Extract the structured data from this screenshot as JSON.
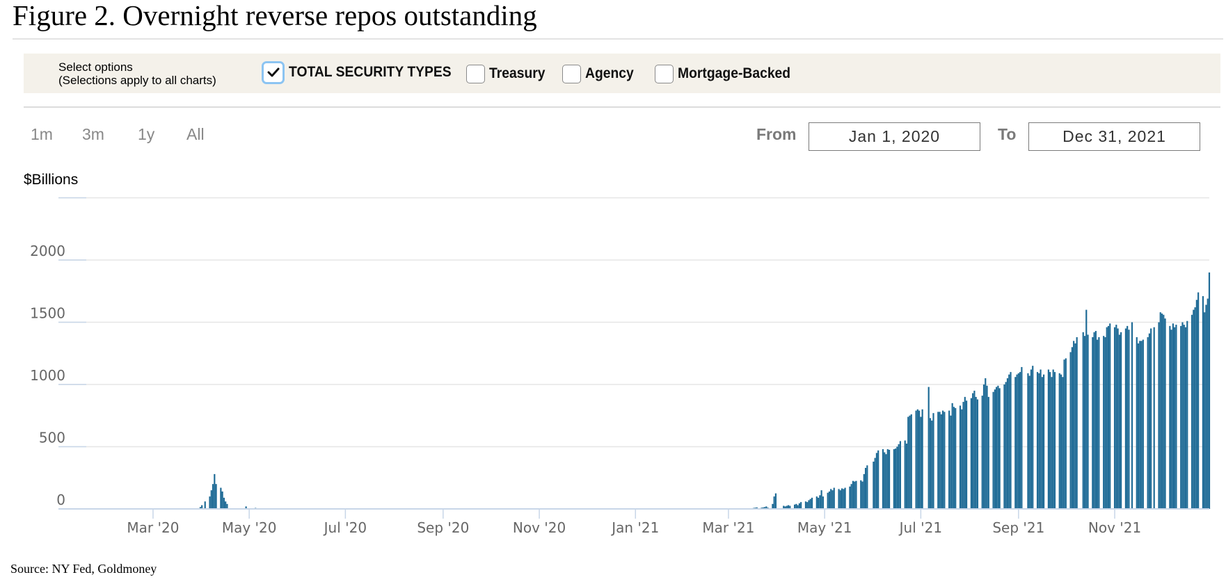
{
  "figure_title": "Figure 2. Overnight reverse repos outstanding",
  "options": {
    "label_line1": "Select options",
    "label_line2": "(Selections apply to all charts)",
    "checkboxes": [
      {
        "label": "TOTAL SECURITY TYPES",
        "checked": true
      },
      {
        "label": "Treasury",
        "checked": false
      },
      {
        "label": "Agency",
        "checked": false
      },
      {
        "label": "Mortgage-Backed",
        "checked": false
      }
    ]
  },
  "range_buttons": [
    "1m",
    "3m",
    "1y",
    "All"
  ],
  "date_range": {
    "from_label": "From",
    "from_value": "Jan 1, 2020",
    "to_label": "To",
    "to_value": "Dec 31, 2021"
  },
  "colors": {
    "bar": "#1f6b96",
    "grid": "#e6e6e6",
    "axis": "#c8d6e8"
  },
  "source": "Source: NY Fed, Goldmoney",
  "chart_data": {
    "type": "bar",
    "title": "Figure 2. Overnight reverse repos outstanding",
    "xlabel": "",
    "ylabel": "$Billions",
    "ylim": [
      0,
      2500
    ],
    "yticks": [
      0,
      500,
      1000,
      1500,
      2000
    ],
    "xticks": [
      {
        "label": "Mar '20",
        "date": "2020-03-01"
      },
      {
        "label": "May '20",
        "date": "2020-05-01"
      },
      {
        "label": "Jul '20",
        "date": "2020-07-01"
      },
      {
        "label": "Sep '20",
        "date": "2020-09-01"
      },
      {
        "label": "Nov '20",
        "date": "2020-11-01"
      },
      {
        "label": "Jan '21",
        "date": "2021-01-01"
      },
      {
        "label": "Mar '21",
        "date": "2021-03-01"
      },
      {
        "label": "May '21",
        "date": "2021-05-01"
      },
      {
        "label": "Jul '21",
        "date": "2021-07-01"
      },
      {
        "label": "Sep '21",
        "date": "2021-09-01"
      },
      {
        "label": "Nov '21",
        "date": "2021-11-01"
      }
    ],
    "grid": true,
    "series": [
      {
        "values_description_note": "",
        "points": [
          [
            "2020-01-16",
            5
          ],
          [
            "2020-03-19",
            5
          ],
          [
            "2020-03-31",
            15
          ],
          [
            "2020-04-01",
            30
          ],
          [
            "2020-04-03",
            60
          ],
          [
            "2020-04-06",
            100
          ],
          [
            "2020-04-07",
            150
          ],
          [
            "2020-04-08",
            200
          ],
          [
            "2020-04-09",
            280
          ],
          [
            "2020-04-10",
            200
          ],
          [
            "2020-04-13",
            170
          ],
          [
            "2020-04-14",
            140
          ],
          [
            "2020-04-15",
            90
          ],
          [
            "2020-04-16",
            60
          ],
          [
            "2020-04-17",
            40
          ],
          [
            "2020-04-29",
            20
          ],
          [
            "2020-05-05",
            8
          ],
          [
            "2021-03-17",
            8
          ],
          [
            "2021-03-18",
            10
          ],
          [
            "2021-03-19",
            12
          ],
          [
            "2021-03-22",
            10
          ],
          [
            "2021-03-23",
            12
          ],
          [
            "2021-03-24",
            15
          ],
          [
            "2021-03-25",
            20
          ],
          [
            "2021-03-26",
            10
          ],
          [
            "2021-03-29",
            40
          ],
          [
            "2021-03-30",
            100
          ],
          [
            "2021-03-31",
            125
          ],
          [
            "2021-04-05",
            25
          ],
          [
            "2021-04-06",
            20
          ],
          [
            "2021-04-07",
            25
          ],
          [
            "2021-04-08",
            30
          ],
          [
            "2021-04-09",
            25
          ],
          [
            "2021-04-12",
            35
          ],
          [
            "2021-04-13",
            40
          ],
          [
            "2021-04-14",
            30
          ],
          [
            "2021-04-15",
            45
          ],
          [
            "2021-04-16",
            55
          ],
          [
            "2021-04-19",
            60
          ],
          [
            "2021-04-20",
            55
          ],
          [
            "2021-04-21",
            70
          ],
          [
            "2021-04-22",
            80
          ],
          [
            "2021-04-23",
            90
          ],
          [
            "2021-04-26",
            100
          ],
          [
            "2021-04-27",
            90
          ],
          [
            "2021-04-28",
            110
          ],
          [
            "2021-04-29",
            150
          ],
          [
            "2021-04-30",
            100
          ],
          [
            "2021-05-03",
            130
          ],
          [
            "2021-05-04",
            140
          ],
          [
            "2021-05-05",
            160
          ],
          [
            "2021-05-06",
            150
          ],
          [
            "2021-05-07",
            170
          ],
          [
            "2021-05-10",
            160
          ],
          [
            "2021-05-11",
            150
          ],
          [
            "2021-05-12",
            165
          ],
          [
            "2021-05-13",
            160
          ],
          [
            "2021-05-14",
            170
          ],
          [
            "2021-05-17",
            180
          ],
          [
            "2021-05-18",
            200
          ],
          [
            "2021-05-19",
            225
          ],
          [
            "2021-05-20",
            220
          ],
          [
            "2021-05-21",
            225
          ],
          [
            "2021-05-24",
            230
          ],
          [
            "2021-05-25",
            220
          ],
          [
            "2021-05-26",
            280
          ],
          [
            "2021-05-27",
            330
          ],
          [
            "2021-05-28",
            350
          ],
          [
            "2021-06-01",
            380
          ],
          [
            "2021-06-02",
            410
          ],
          [
            "2021-06-03",
            450
          ],
          [
            "2021-06-04",
            470
          ],
          [
            "2021-06-07",
            480
          ],
          [
            "2021-06-08",
            455
          ],
          [
            "2021-06-09",
            440
          ],
          [
            "2021-06-10",
            480
          ],
          [
            "2021-06-11",
            475
          ],
          [
            "2021-06-14",
            480
          ],
          [
            "2021-06-15",
            485
          ],
          [
            "2021-06-16",
            500
          ],
          [
            "2021-06-17",
            520
          ],
          [
            "2021-06-18",
            545
          ],
          [
            "2021-06-21",
            550
          ],
          [
            "2021-06-22",
            525
          ],
          [
            "2021-06-23",
            740
          ],
          [
            "2021-06-24",
            750
          ],
          [
            "2021-06-25",
            760
          ],
          [
            "2021-06-28",
            790
          ],
          [
            "2021-06-29",
            800
          ],
          [
            "2021-06-30",
            790
          ],
          [
            "2021-07-01",
            740
          ],
          [
            "2021-07-02",
            800
          ],
          [
            "2021-07-06",
            980
          ],
          [
            "2021-07-07",
            730
          ],
          [
            "2021-07-08",
            710
          ],
          [
            "2021-07-09",
            770
          ],
          [
            "2021-07-12",
            780
          ],
          [
            "2021-07-13",
            780
          ],
          [
            "2021-07-14",
            760
          ],
          [
            "2021-07-15",
            790
          ],
          [
            "2021-07-16",
            780
          ],
          [
            "2021-07-19",
            790
          ],
          [
            "2021-07-20",
            750
          ],
          [
            "2021-07-21",
            850
          ],
          [
            "2021-07-22",
            820
          ],
          [
            "2021-07-23",
            810
          ],
          [
            "2021-07-26",
            830
          ],
          [
            "2021-07-27",
            800
          ],
          [
            "2021-07-28",
            860
          ],
          [
            "2021-07-29",
            900
          ],
          [
            "2021-07-30",
            870
          ],
          [
            "2021-08-02",
            890
          ],
          [
            "2021-08-03",
            930
          ],
          [
            "2021-08-04",
            950
          ],
          [
            "2021-08-05",
            900
          ],
          [
            "2021-08-06",
            880
          ],
          [
            "2021-08-09",
            910
          ],
          [
            "2021-08-10",
            1000
          ],
          [
            "2021-08-11",
            1050
          ],
          [
            "2021-08-12",
            990
          ],
          [
            "2021-08-13",
            900
          ],
          [
            "2021-08-16",
            940
          ],
          [
            "2021-08-17",
            960
          ],
          [
            "2021-08-18",
            980
          ],
          [
            "2021-08-19",
            990
          ],
          [
            "2021-08-20",
            970
          ],
          [
            "2021-08-23",
            1000
          ],
          [
            "2021-08-24",
            1020
          ],
          [
            "2021-08-25",
            1050
          ],
          [
            "2021-08-26",
            1080
          ],
          [
            "2021-08-27",
            1100
          ],
          [
            "2021-08-30",
            1060
          ],
          [
            "2021-08-31",
            1080
          ],
          [
            "2021-09-01",
            1090
          ],
          [
            "2021-09-02",
            1100
          ],
          [
            "2021-09-03",
            1140
          ],
          [
            "2021-09-07",
            1090
          ],
          [
            "2021-09-08",
            1070
          ],
          [
            "2021-09-09",
            1120
          ],
          [
            "2021-09-10",
            1150
          ],
          [
            "2021-09-13",
            1100
          ],
          [
            "2021-09-14",
            1090
          ],
          [
            "2021-09-15",
            1120
          ],
          [
            "2021-09-16",
            1060
          ],
          [
            "2021-09-17",
            1080
          ],
          [
            "2021-09-20",
            1120
          ],
          [
            "2021-09-21",
            1100
          ],
          [
            "2021-09-22",
            1060
          ],
          [
            "2021-09-23",
            1120
          ],
          [
            "2021-09-24",
            1100
          ],
          [
            "2021-09-27",
            1090
          ],
          [
            "2021-09-28",
            1080
          ],
          [
            "2021-09-29",
            1060
          ],
          [
            "2021-09-30",
            1200
          ],
          [
            "2021-10-01",
            1210
          ],
          [
            "2021-10-04",
            1260
          ],
          [
            "2021-10-05",
            1300
          ],
          [
            "2021-10-06",
            1350
          ],
          [
            "2021-10-07",
            1330
          ],
          [
            "2021-10-08",
            1380
          ],
          [
            "2021-10-12",
            1420
          ],
          [
            "2021-10-13",
            1390
          ],
          [
            "2021-10-14",
            1600
          ],
          [
            "2021-10-15",
            1400
          ],
          [
            "2021-10-18",
            1380
          ],
          [
            "2021-10-19",
            1420
          ],
          [
            "2021-10-20",
            1430
          ],
          [
            "2021-10-21",
            1360
          ],
          [
            "2021-10-22",
            1380
          ],
          [
            "2021-10-25",
            1390
          ],
          [
            "2021-10-26",
            1380
          ],
          [
            "2021-10-27",
            1460
          ],
          [
            "2021-10-28",
            1470
          ],
          [
            "2021-10-29",
            1490
          ],
          [
            "2021-11-01",
            1460
          ],
          [
            "2021-11-02",
            1480
          ],
          [
            "2021-11-03",
            1450
          ],
          [
            "2021-11-04",
            1400
          ],
          [
            "2021-11-05",
            1420
          ],
          [
            "2021-11-08",
            1450
          ],
          [
            "2021-11-09",
            1470
          ],
          [
            "2021-11-10",
            1440
          ],
          [
            "2021-11-12",
            1500
          ],
          [
            "2021-11-15",
            1380
          ],
          [
            "2021-11-16",
            1330
          ],
          [
            "2021-11-17",
            1350
          ],
          [
            "2021-11-18",
            1350
          ],
          [
            "2021-11-19",
            1360
          ],
          [
            "2021-11-22",
            1380
          ],
          [
            "2021-11-23",
            1410
          ],
          [
            "2021-11-24",
            1450
          ],
          [
            "2021-11-26",
            1460
          ],
          [
            "2021-11-29",
            1500
          ],
          [
            "2021-11-30",
            1580
          ],
          [
            "2021-12-01",
            1570
          ],
          [
            "2021-12-02",
            1560
          ],
          [
            "2021-12-03",
            1530
          ],
          [
            "2021-12-06",
            1470
          ],
          [
            "2021-12-07",
            1440
          ],
          [
            "2021-12-08",
            1490
          ],
          [
            "2021-12-09",
            1460
          ],
          [
            "2021-12-10",
            1480
          ],
          [
            "2021-12-13",
            1470
          ],
          [
            "2021-12-14",
            1500
          ],
          [
            "2021-12-15",
            1480
          ],
          [
            "2021-12-16",
            1460
          ],
          [
            "2021-12-17",
            1510
          ],
          [
            "2021-12-20",
            1560
          ],
          [
            "2021-12-21",
            1600
          ],
          [
            "2021-12-22",
            1620
          ],
          [
            "2021-12-23",
            1680
          ],
          [
            "2021-12-24",
            1740
          ],
          [
            "2021-12-27",
            1710
          ],
          [
            "2021-12-28",
            1580
          ],
          [
            "2021-12-29",
            1640
          ],
          [
            "2021-12-30",
            1690
          ],
          [
            "2021-12-31",
            1900
          ]
        ]
      }
    ]
  }
}
